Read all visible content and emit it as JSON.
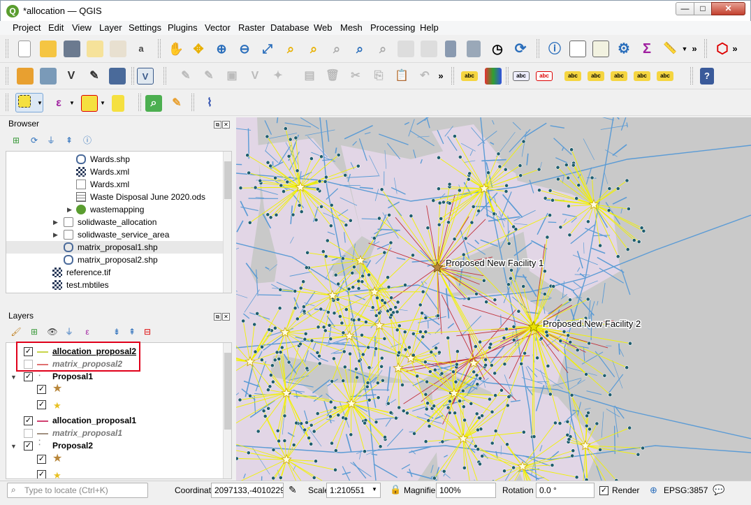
{
  "window": {
    "title": "*allocation — QGIS",
    "min_glyph": "—",
    "max_glyph": "□",
    "close_glyph": "✕"
  },
  "menu": [
    "Project",
    "Edit",
    "View",
    "Layer",
    "Settings",
    "Plugins",
    "Vector",
    "Raster",
    "Database",
    "Web",
    "Mesh",
    "Processing",
    "Help"
  ],
  "toolbar": {
    "overflow_glyph": "»"
  },
  "browser": {
    "title": "Browser",
    "items": [
      {
        "label": "Wards.shp",
        "icon": "polygon-layer-icon"
      },
      {
        "label": "Wards.xml",
        "icon": "raster-layer-icon"
      },
      {
        "label": "Wards.xml",
        "icon": "file-icon"
      },
      {
        "label": "Waste Disposal June 2020.ods",
        "icon": "spreadsheet-icon"
      },
      {
        "label": "wastemapping",
        "icon": "qgis-project-icon"
      },
      {
        "label": "solidwaste_allocation",
        "icon": "folder-icon"
      },
      {
        "label": "solidwaste_service_area",
        "icon": "folder-icon"
      },
      {
        "label": "matrix_proposal1.shp",
        "icon": "polygon-layer-icon"
      },
      {
        "label": "matrix_proposal2.shp",
        "icon": "polygon-layer-icon"
      },
      {
        "label": "reference.tif",
        "icon": "raster-layer-icon"
      },
      {
        "label": "test.mbtiles",
        "icon": "raster-layer-icon"
      }
    ]
  },
  "layers": {
    "title": "Layers",
    "items": [
      {
        "label": "allocation_proposal2",
        "checked": true,
        "color": "#c8d44a"
      },
      {
        "label": "matrix_proposal2",
        "checked": false,
        "color": "#e07070"
      },
      {
        "label": "Proposal1",
        "checked": true
      },
      {
        "label": "allocation_proposal1",
        "checked": true,
        "color": "#d04070"
      },
      {
        "label": "matrix_proposal1",
        "checked": false,
        "color": "#a09080"
      },
      {
        "label": "Proposal2",
        "checked": true
      }
    ],
    "symbol_colors": {
      "large_star": "#b8863a",
      "small_star": "#e8c020"
    }
  },
  "map": {
    "labels": [
      "Proposed New Facility 1",
      "Proposed New Facility 2"
    ],
    "colors": {
      "background": "#c9c9c9",
      "land": "#e2d6e6",
      "roads": "#5b9bd5",
      "allocation_lines": "#f2f200",
      "matrix_lines": "#c0303a",
      "points": "#1f5d6e"
    }
  },
  "status": {
    "locate_placeholder": "Type to locate (Ctrl+K)",
    "coordinate_label": "Coordinate",
    "coordinate_value": "2097133,-4010229",
    "scale_label": "Scale",
    "scale_value": "1:210551",
    "magnifier_label": "Magnifier",
    "magnifier_value": "100%",
    "rotation_label": "Rotation",
    "rotation_value": "0.0 °",
    "render_label": "Render",
    "render_checked": true,
    "crs_label": "EPSG:3857"
  }
}
